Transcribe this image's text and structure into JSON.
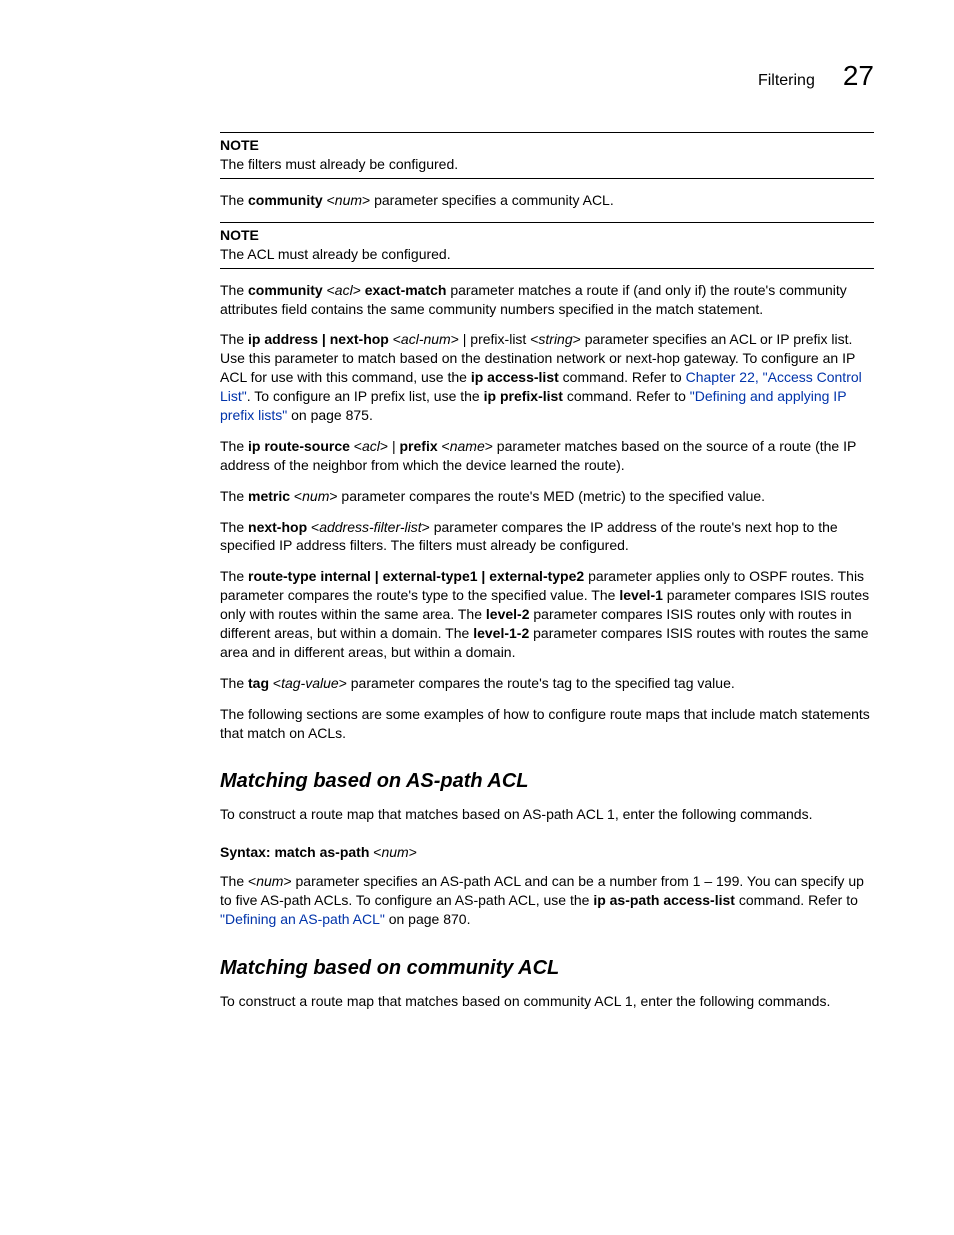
{
  "header": {
    "title": "Filtering",
    "chapter": "27"
  },
  "note1": {
    "label": "NOTE",
    "body": "The filters must already be configured."
  },
  "p_community_num": {
    "pre": "The ",
    "b1": "community",
    "mid": " <",
    "i1": "num",
    "post": "> parameter specifies a community ACL."
  },
  "note2": {
    "label": "NOTE",
    "body": "The ACL must already be configured."
  },
  "p_community_acl": {
    "pre": "The ",
    "b1": "community",
    "s1": " <",
    "i1": "acl",
    "s2": "> ",
    "b2": "exact-match",
    "rest": " parameter matches a route if (and only if) the route's community attributes field contains the same community numbers specified in the match statement."
  },
  "p_ipaddress": {
    "pre": "The ",
    "b1": "ip address | next-hop",
    "s1": " <",
    "i1": "acl-num",
    "s2": "> | prefix-list <",
    "i2": "string",
    "s3": "> parameter specifies an ACL or IP prefix list. Use this parameter to match based on the destination network or next-hop gateway. To configure an IP ACL for use with this command, use the ",
    "b2": "ip access-list",
    "s4": " command. Refer to ",
    "link1": "Chapter 22, \"Access Control List\"",
    "s5": ". To configure an IP prefix list, use the ",
    "b3": "ip prefix-list",
    "s6": " command. Refer to ",
    "link2": "\"Defining and applying IP prefix lists\"",
    "s7": " on page 875."
  },
  "p_routesource": {
    "pre": "The ",
    "b1": "ip route-source",
    "s1": " <",
    "i1": "acl",
    "s2": "> | ",
    "b2": "prefix",
    "s3": " <",
    "i2": "name",
    "s4": "> parameter matches based on the source of a route (the IP address of the neighbor from which the device learned the route)."
  },
  "p_metric": {
    "pre": "The ",
    "b1": "metric",
    "s1": " <",
    "i1": "num",
    "s2": "> parameter compares the route's MED (metric) to the specified value."
  },
  "p_nexthop": {
    "pre": "The ",
    "b1": "next-hop",
    "s1": " <",
    "i1": "address-filter-list",
    "s2": "> parameter compares the IP address of the route's next hop to the specified IP address filters.  The filters must already be configured."
  },
  "p_routetype": {
    "pre": "The ",
    "b1": "route-type internal | external-type1 | external-type2",
    "s1": " parameter applies only to OSPF routes. This parameter compares the route's type to the specified value.  The ",
    "b2": "level-1",
    "s2": " parameter compares ISIS routes only with routes within the same area. The ",
    "b3": "level-2",
    "s3": " parameter compares ISIS routes only with routes in different areas, but within a domain. The ",
    "b4": "level-1-2",
    "s4": " parameter compares ISIS routes with routes the same area and in different areas, but within a domain."
  },
  "p_tag": {
    "pre": "The ",
    "b1": "tag",
    "s1": " <",
    "i1": "tag-value",
    "s2": "> parameter compares the route's tag to the specified tag value."
  },
  "p_following": "The following sections are some examples of how to configure route maps that include match statements that match on ACLs.",
  "sect1": {
    "title": "Matching based on AS-path ACL",
    "intro": "To construct a route map that matches based on AS-path ACL 1, enter the following commands.",
    "syntax_label": "Syntax:  ",
    "syntax_cmd": "match as-path",
    "syntax_s1": " <",
    "syntax_i1": "num",
    "syntax_s2": ">",
    "body_pre": "The <",
    "body_i1": "num",
    "body_s1": "> parameter specifies an AS-path ACL and can be a number from 1 – 199. You can specify up to five AS-path ACLs. To configure an AS-path ACL, use the ",
    "body_b1": "ip as-path access-list",
    "body_s2": " command. Refer to ",
    "body_link": "\"Defining an AS-path ACL\"",
    "body_s3": " on page 870."
  },
  "sect2": {
    "title": "Matching based on community ACL",
    "intro": "To construct a route map that matches based on community ACL 1, enter the following commands."
  }
}
